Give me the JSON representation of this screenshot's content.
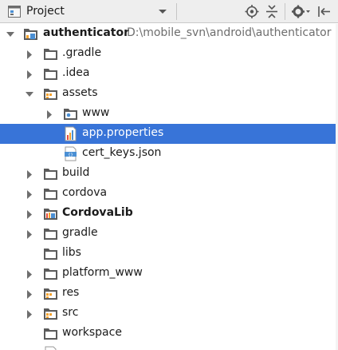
{
  "toolbar": {
    "view_label": "Project",
    "view_icon": "project-view-icon",
    "dropdown_icon": "dropdown-triangle-icon",
    "buttons": [
      {
        "name": "locate-icon"
      },
      {
        "name": "collapse-all-icon"
      },
      {
        "name": "gear-icon"
      },
      {
        "name": "hide-panel-icon"
      }
    ]
  },
  "colors": {
    "selection": "#3874d8",
    "folder": "#5b5b5b",
    "source_folder_mark": "#f4a22d",
    "module_blue": "#4a8fd4"
  },
  "tree": {
    "root": {
      "label": "authenticator",
      "path": "D:\\mobile_svn\\android\\authenticator"
    },
    "gradle_dir": ".gradle",
    "idea_dir": ".idea",
    "assets_dir": "assets",
    "www_dir": "www",
    "app_properties": "app.properties",
    "cert_keys": "cert_keys.json",
    "build_dir": "build",
    "cordova_dir": "cordova",
    "cordovalib_dir": "CordovaLib",
    "gradle_dir2": "gradle",
    "libs_dir": "libs",
    "platform_www_dir": "platform_www",
    "res_dir": "res",
    "src_dir": "src",
    "workspace_dir": "workspace"
  }
}
